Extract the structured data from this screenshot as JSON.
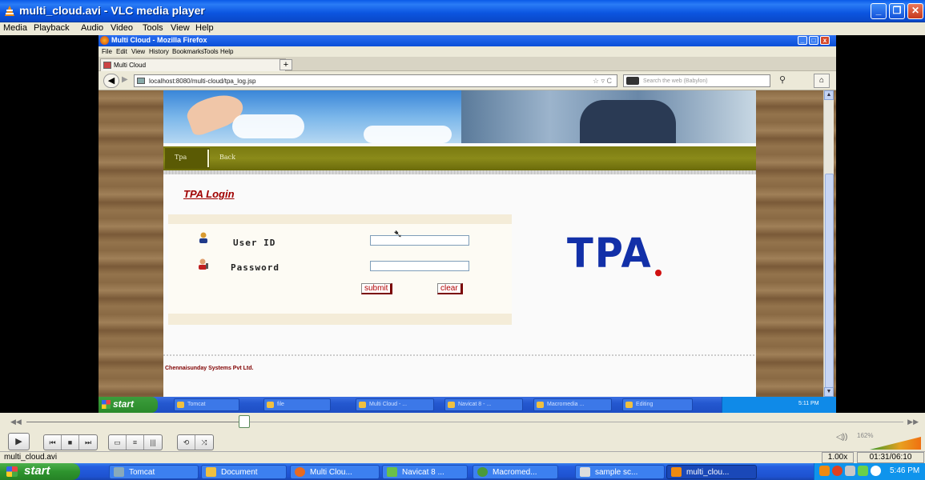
{
  "vlc": {
    "title": "multi_cloud.avi - VLC media player",
    "menu": [
      "Media",
      "Playback",
      "Audio",
      "Video",
      "Tools",
      "View",
      "Help"
    ],
    "window_buttons": {
      "minimize": "_",
      "maximize": "❐",
      "close": "✕"
    },
    "status": {
      "filename": "multi_cloud.avi",
      "rate": "1.00x",
      "time": "01:31/06:10"
    },
    "volume": {
      "label": "162%",
      "level_percent": 162
    },
    "seek": {
      "position_fraction": 0.248,
      "back_glyph": "◀◀",
      "forward_glyph": "▶▶"
    },
    "controls": {
      "play": "▶",
      "group1": [
        "⏮",
        "■",
        "⏭"
      ],
      "group2": [
        "▭",
        "≡",
        "|||"
      ],
      "group3": [
        "⟲",
        "⤨"
      ]
    }
  },
  "firefox": {
    "title": "Multi Cloud - Mozilla Firefox",
    "menu": [
      "File",
      "Edit",
      "View",
      "History",
      "Bookmarks",
      "Tools",
      "Help"
    ],
    "tab_label": "Multi Cloud",
    "new_tab": "+",
    "url": "localhost:8080/multi-cloud/tpa_log.jsp",
    "search_placeholder": "Search the web (Babylon)",
    "search_engine_icon": "babylon-icon"
  },
  "page": {
    "nav_items": [
      "Tpa",
      "Back"
    ],
    "login_title": "TPA Login",
    "user_label": "User ID",
    "password_label": "Password",
    "user_value": "",
    "password_value": "",
    "submit_label": "submit",
    "clear_label": "clear",
    "logo_text": "TPA",
    "footer": "Chennaisunday Systems Pvt Ltd."
  },
  "inner_taskbar": {
    "start": "start",
    "tasks": [
      "Tomcat",
      "file",
      "Multi Cloud - ...",
      "Navicat 8 - ...",
      "Macromedia ...",
      "Editing"
    ],
    "clock": "5:11 PM"
  },
  "taskbar": {
    "start": "start",
    "tasks": [
      "Tomcat",
      "Document",
      "Multi Clou...",
      "Navicat 8 ...",
      "Macromed...",
      "sample sc...",
      "multi_clou..."
    ],
    "clock": "5:46 PM"
  },
  "colors": {
    "xp_blue": "#245ee0",
    "nav_olive": "#7a7a10",
    "login_red": "#a00000",
    "logo_blue": "#1230a8"
  }
}
